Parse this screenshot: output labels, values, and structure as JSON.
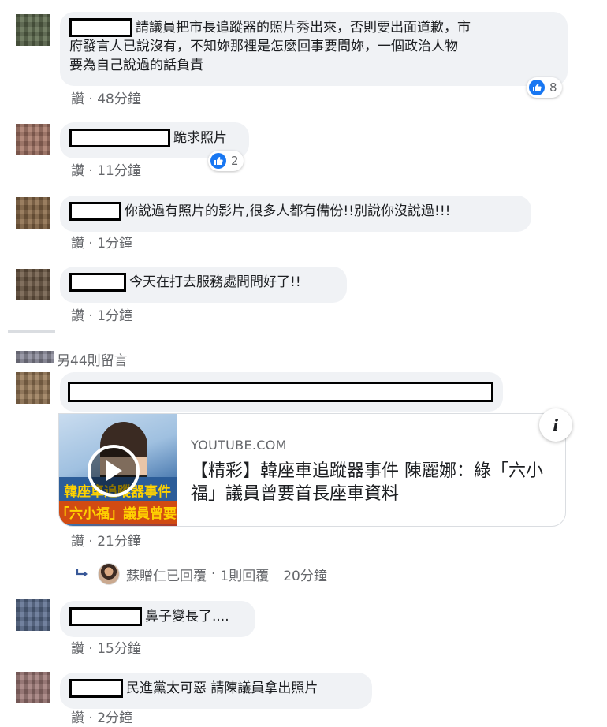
{
  "comments": [
    {
      "text_lines": [
        "請議員把市長追蹤器的照片秀出來，否則要出面道歉，市",
        "府發言人已說沒有，不知妳那裡是怎麼回事要問妳，一個政治人物",
        "要為自己說過的話負責"
      ],
      "like_label": "讚",
      "time": "48分鐘",
      "reactions": "8"
    },
    {
      "text": "跪求照片",
      "like_label": "讚",
      "time": "11分鐘",
      "reactions": "2"
    },
    {
      "text": "你說過有照片的影片,很多人都有備份!!別說你沒說過!!!",
      "like_label": "讚",
      "time": "1分鐘"
    },
    {
      "text": "今天在打去服務處問問好了!!",
      "like_label": "讚",
      "time": "1分鐘"
    }
  ],
  "more_comments": "另44則留言",
  "link_comment": {
    "like_label": "讚",
    "time": "21分鐘",
    "card": {
      "domain": "YOUTUBE.COM",
      "title": "【精彩】韓座車追蹤器事件 陳麗娜：綠「六小福」議員曾要首長座車資料",
      "thumb_text_1": "韓座車追蹤器事件",
      "thumb_text_2": "「六小福」議員曾要首長",
      "info_glyph": "i"
    },
    "reply": {
      "text": "蘇贈仁已回覆",
      "separator": "·",
      "count": "1則回覆",
      "time": "20分鐘"
    }
  },
  "comments_2": [
    {
      "text": "鼻子變長了....",
      "like_label": "讚",
      "time": "15分鐘"
    },
    {
      "text": "民進黨太可惡 請陳議員拿出照片",
      "like_label": "讚",
      "time": "2分鐘"
    }
  ],
  "separator": "·",
  "colors": {
    "like_blue": "#1877f2",
    "meta_gray": "#65676b",
    "bubble_bg": "#f0f2f5"
  },
  "icons": {
    "reaction": "like-thumb-icon",
    "play": "play-icon",
    "reply_arrow": "reply-arrow-icon",
    "info": "info-icon"
  }
}
